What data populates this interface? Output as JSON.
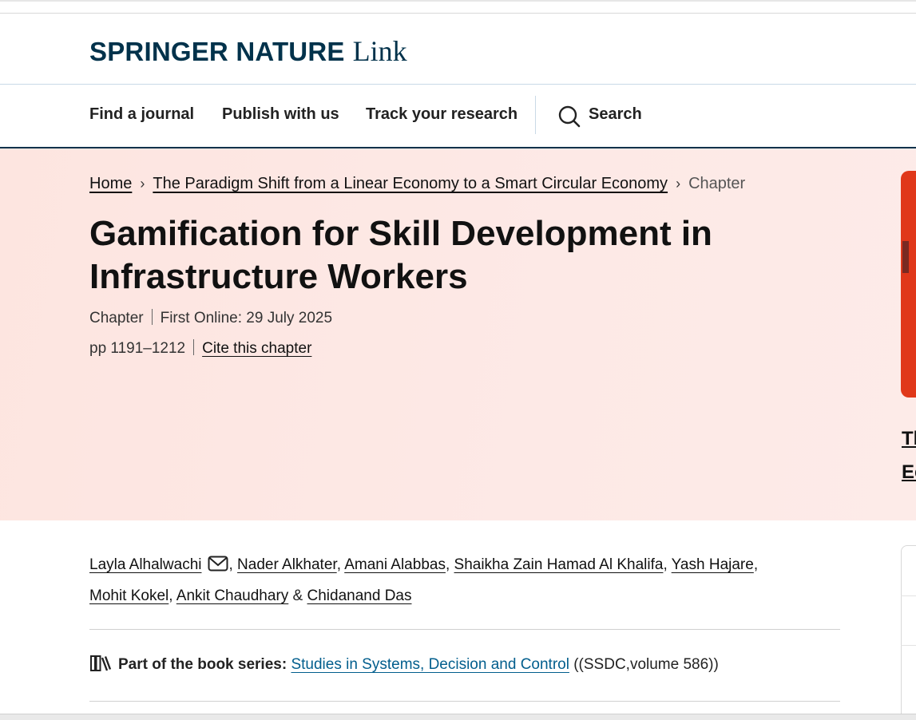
{
  "header": {
    "logo_brand": "SPRINGER NATURE",
    "logo_suffix": "Link"
  },
  "nav": {
    "items": [
      {
        "label": "Find a journal"
      },
      {
        "label": "Publish with us"
      },
      {
        "label": "Track your research"
      }
    ],
    "search_label": "Search"
  },
  "breadcrumb": {
    "home": "Home",
    "book": "The Paradigm Shift from a Linear Economy to a Smart Circular Economy",
    "current": "Chapter"
  },
  "chapter": {
    "title": "Gamification for Skill Development in Infrastructure Workers",
    "type": "Chapter",
    "first_online": "First Online: 29 July 2025",
    "pages": "pp 1191–1212",
    "cite_label": "Cite this chapter"
  },
  "sidebar_peek": {
    "line1": "Th",
    "line2": "Ec",
    "accent_color": "#e0381a"
  },
  "authors": [
    "Layla Alhalwachi",
    "Nader Alkhater",
    "Amani Alabbas",
    "Shaikha Zain Hamad Al Khalifa",
    "Yash Hajare",
    "Mohit Kokel",
    "Ankit Chaudhary",
    "Chidanand Das"
  ],
  "series": {
    "label": "Part of the book series:",
    "name": "Studies in Systems, Decision and Control",
    "volume": "((SSDC,volume 586))"
  },
  "colors": {
    "brand": "#01324b",
    "link": "#025e8d",
    "hero_bg": "#fde7e3"
  }
}
